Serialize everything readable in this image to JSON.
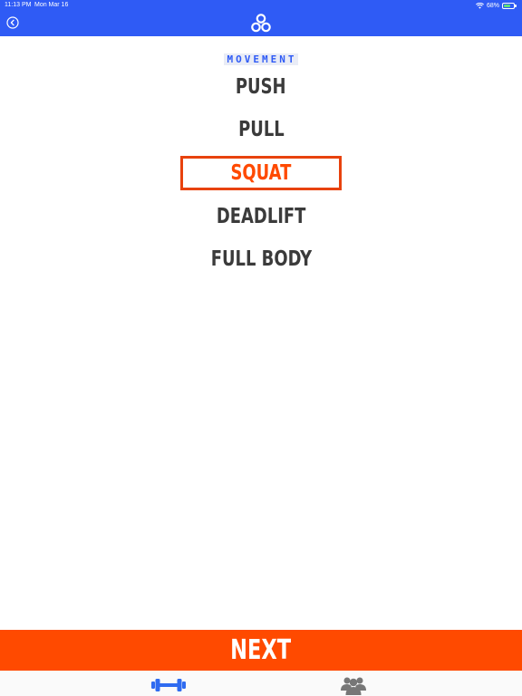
{
  "status_bar": {
    "time": "11:13 PM",
    "date": "Mon Mar 16",
    "battery": "68%",
    "battery_level": 0.68
  },
  "header": {
    "back_icon": "chevron-left-circle-icon",
    "logo_icon": "app-logo-icon"
  },
  "section": {
    "label": "MOVEMENT"
  },
  "options": [
    {
      "label": "PUSH",
      "selected": false
    },
    {
      "label": "PULL",
      "selected": false
    },
    {
      "label": "SQUAT",
      "selected": true
    },
    {
      "label": "DEADLIFT",
      "selected": false
    },
    {
      "label": "FULL BODY",
      "selected": false
    }
  ],
  "next_button": {
    "label": "NEXT"
  },
  "tabbar": [
    {
      "icon": "dumbbell-icon",
      "active": true
    },
    {
      "icon": "group-icon",
      "active": false
    }
  ],
  "colors": {
    "header_bg": "#2f5bf5",
    "accent": "#ff4a00",
    "text": "#3b3b3b",
    "tab_active": "#2f6bf0",
    "tab_inactive": "#777777"
  }
}
